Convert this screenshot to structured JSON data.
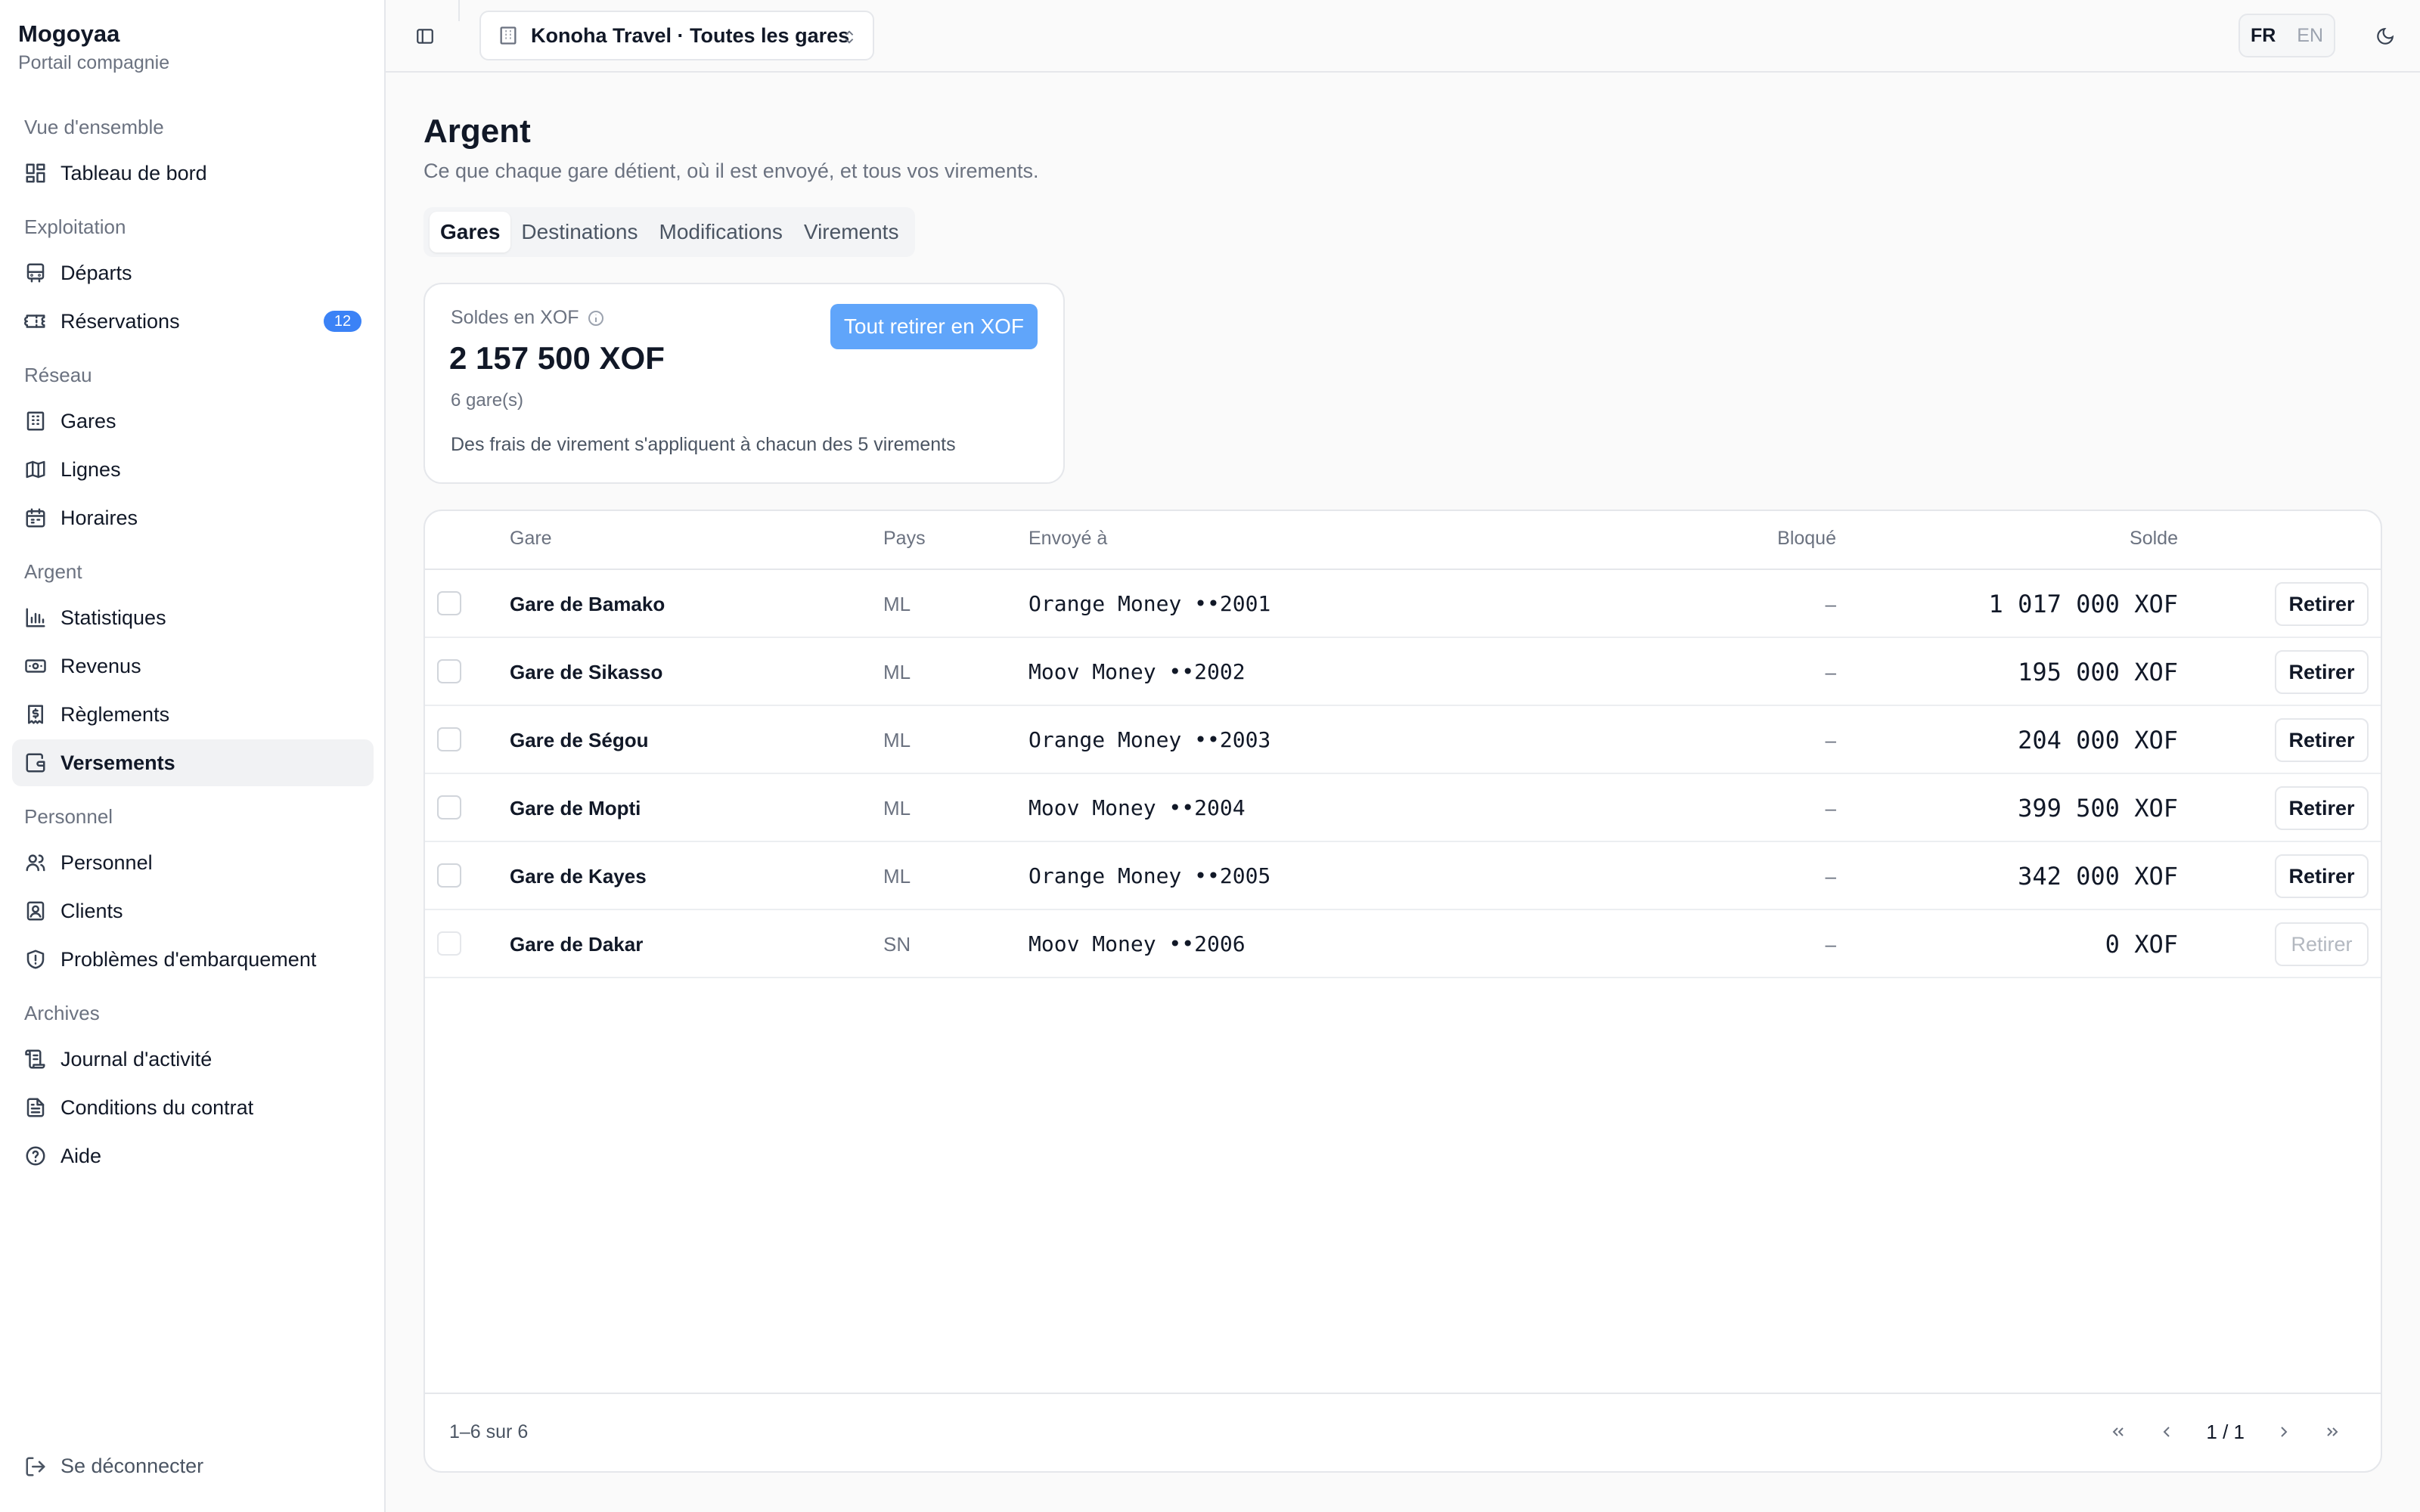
{
  "brand": {
    "name": "Mogoyaa",
    "subtitle": "Portail compagnie"
  },
  "sidebar": {
    "groups": [
      {
        "label": "Vue d'ensemble",
        "items": [
          {
            "label": "Tableau de bord",
            "icon": "dashboard-icon"
          }
        ]
      },
      {
        "label": "Exploitation",
        "items": [
          {
            "label": "Départs",
            "icon": "bus-icon"
          },
          {
            "label": "Réservations",
            "icon": "ticket-icon",
            "badge": "12"
          }
        ]
      },
      {
        "label": "Réseau",
        "items": [
          {
            "label": "Gares",
            "icon": "building-icon"
          },
          {
            "label": "Lignes",
            "icon": "map-icon"
          },
          {
            "label": "Horaires",
            "icon": "calendar-icon"
          }
        ]
      },
      {
        "label": "Argent",
        "items": [
          {
            "label": "Statistiques",
            "icon": "bar-chart-icon"
          },
          {
            "label": "Revenus",
            "icon": "banknote-icon"
          },
          {
            "label": "Règlements",
            "icon": "receipt-icon"
          },
          {
            "label": "Versements",
            "icon": "wallet-icon",
            "active": true
          }
        ]
      },
      {
        "label": "Personnel",
        "items": [
          {
            "label": "Personnel",
            "icon": "users-icon"
          },
          {
            "label": "Clients",
            "icon": "contact-icon"
          },
          {
            "label": "Problèmes d'embarquement",
            "icon": "shield-alert-icon"
          }
        ]
      },
      {
        "label": "Archives",
        "items": [
          {
            "label": "Journal d'activité",
            "icon": "scroll-icon"
          },
          {
            "label": "Conditions du contrat",
            "icon": "file-text-icon"
          },
          {
            "label": "Aide",
            "icon": "help-circle-icon"
          }
        ]
      }
    ],
    "logout_label": "Se déconnecter"
  },
  "topbar": {
    "company_selector": "Konoha Travel · Toutes les gares",
    "lang_fr": "FR",
    "lang_en": "EN",
    "active_lang": "FR"
  },
  "page": {
    "title": "Argent",
    "subtitle": "Ce que chaque gare détient, où il est envoyé, et tous vos virements.",
    "tabs": [
      {
        "label": "Gares",
        "active": true
      },
      {
        "label": "Destinations"
      },
      {
        "label": "Modifications"
      },
      {
        "label": "Virements"
      }
    ]
  },
  "balance": {
    "label": "Soldes en XOF",
    "amount": "2 157 500 XOF",
    "count": "6 gare(s)",
    "note": "Des frais de virement s'appliquent à chacun des 5 virements",
    "button": "Tout retirer en XOF"
  },
  "table": {
    "headers": {
      "gare": "Gare",
      "pays": "Pays",
      "envoye": "Envoyé à",
      "bloque": "Bloqué",
      "solde": "Solde"
    },
    "rows": [
      {
        "gare": "Gare de Bamako",
        "pays": "ML",
        "envoye": "Orange Money ••2001",
        "bloque": "–",
        "solde": "1 017 000 XOF",
        "action": "Retirer",
        "enabled": true
      },
      {
        "gare": "Gare de Sikasso",
        "pays": "ML",
        "envoye": "Moov Money ••2002",
        "bloque": "–",
        "solde": "195 000 XOF",
        "action": "Retirer",
        "enabled": true
      },
      {
        "gare": "Gare de Ségou",
        "pays": "ML",
        "envoye": "Orange Money ••2003",
        "bloque": "–",
        "solde": "204 000 XOF",
        "action": "Retirer",
        "enabled": true
      },
      {
        "gare": "Gare de Mopti",
        "pays": "ML",
        "envoye": "Moov Money ••2004",
        "bloque": "–",
        "solde": "399 500 XOF",
        "action": "Retirer",
        "enabled": true
      },
      {
        "gare": "Gare de Kayes",
        "pays": "ML",
        "envoye": "Orange Money ••2005",
        "bloque": "–",
        "solde": "342 000 XOF",
        "action": "Retirer",
        "enabled": true
      },
      {
        "gare": "Gare de Dakar",
        "pays": "SN",
        "envoye": "Moov Money ••2006",
        "bloque": "–",
        "solde": "0 XOF",
        "action": "Retirer",
        "enabled": false
      }
    ],
    "range_text": "1–6 sur 6",
    "page_info": "1 / 1"
  },
  "colors": {
    "accent": "#3b82f6",
    "button": "#60a5fa",
    "active_nav": "#f1f2f4"
  }
}
